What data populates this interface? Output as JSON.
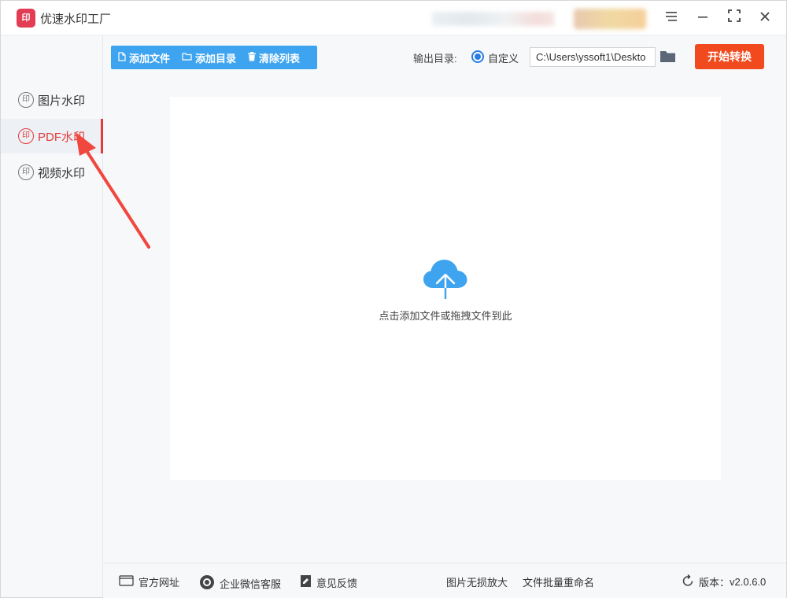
{
  "titlebar": {
    "title": "优速水印工厂",
    "logo_text": "印"
  },
  "sidebar": {
    "items": [
      {
        "label": "图片水印",
        "icon": "印"
      },
      {
        "label": "PDF水印",
        "icon": "印"
      },
      {
        "label": "视频水印",
        "icon": "印"
      }
    ],
    "active_index": 1
  },
  "toolbar": {
    "add_file": "添加文件",
    "add_dir": "添加目录",
    "clear_list": "清除列表"
  },
  "output": {
    "label": "输出目录:",
    "option": "自定义",
    "path": "C:\\Users\\yssoft1\\Deskto"
  },
  "start_button": "开始转换",
  "dropzone": {
    "text": "点击添加文件或拖拽文件到此"
  },
  "footer": {
    "website": "官方网址",
    "wechat": "企业微信客服",
    "feedback": "意见反馈",
    "upscale": "图片无损放大",
    "rename": "文件批量重命名",
    "version_label": "版本：",
    "version": "v2.0.6.0"
  },
  "colors": {
    "accent_blue": "#3ea4ef",
    "active_red": "#e23b3b",
    "start_orange": "#f04a1e",
    "annotation_arrow": "#f0473f"
  }
}
